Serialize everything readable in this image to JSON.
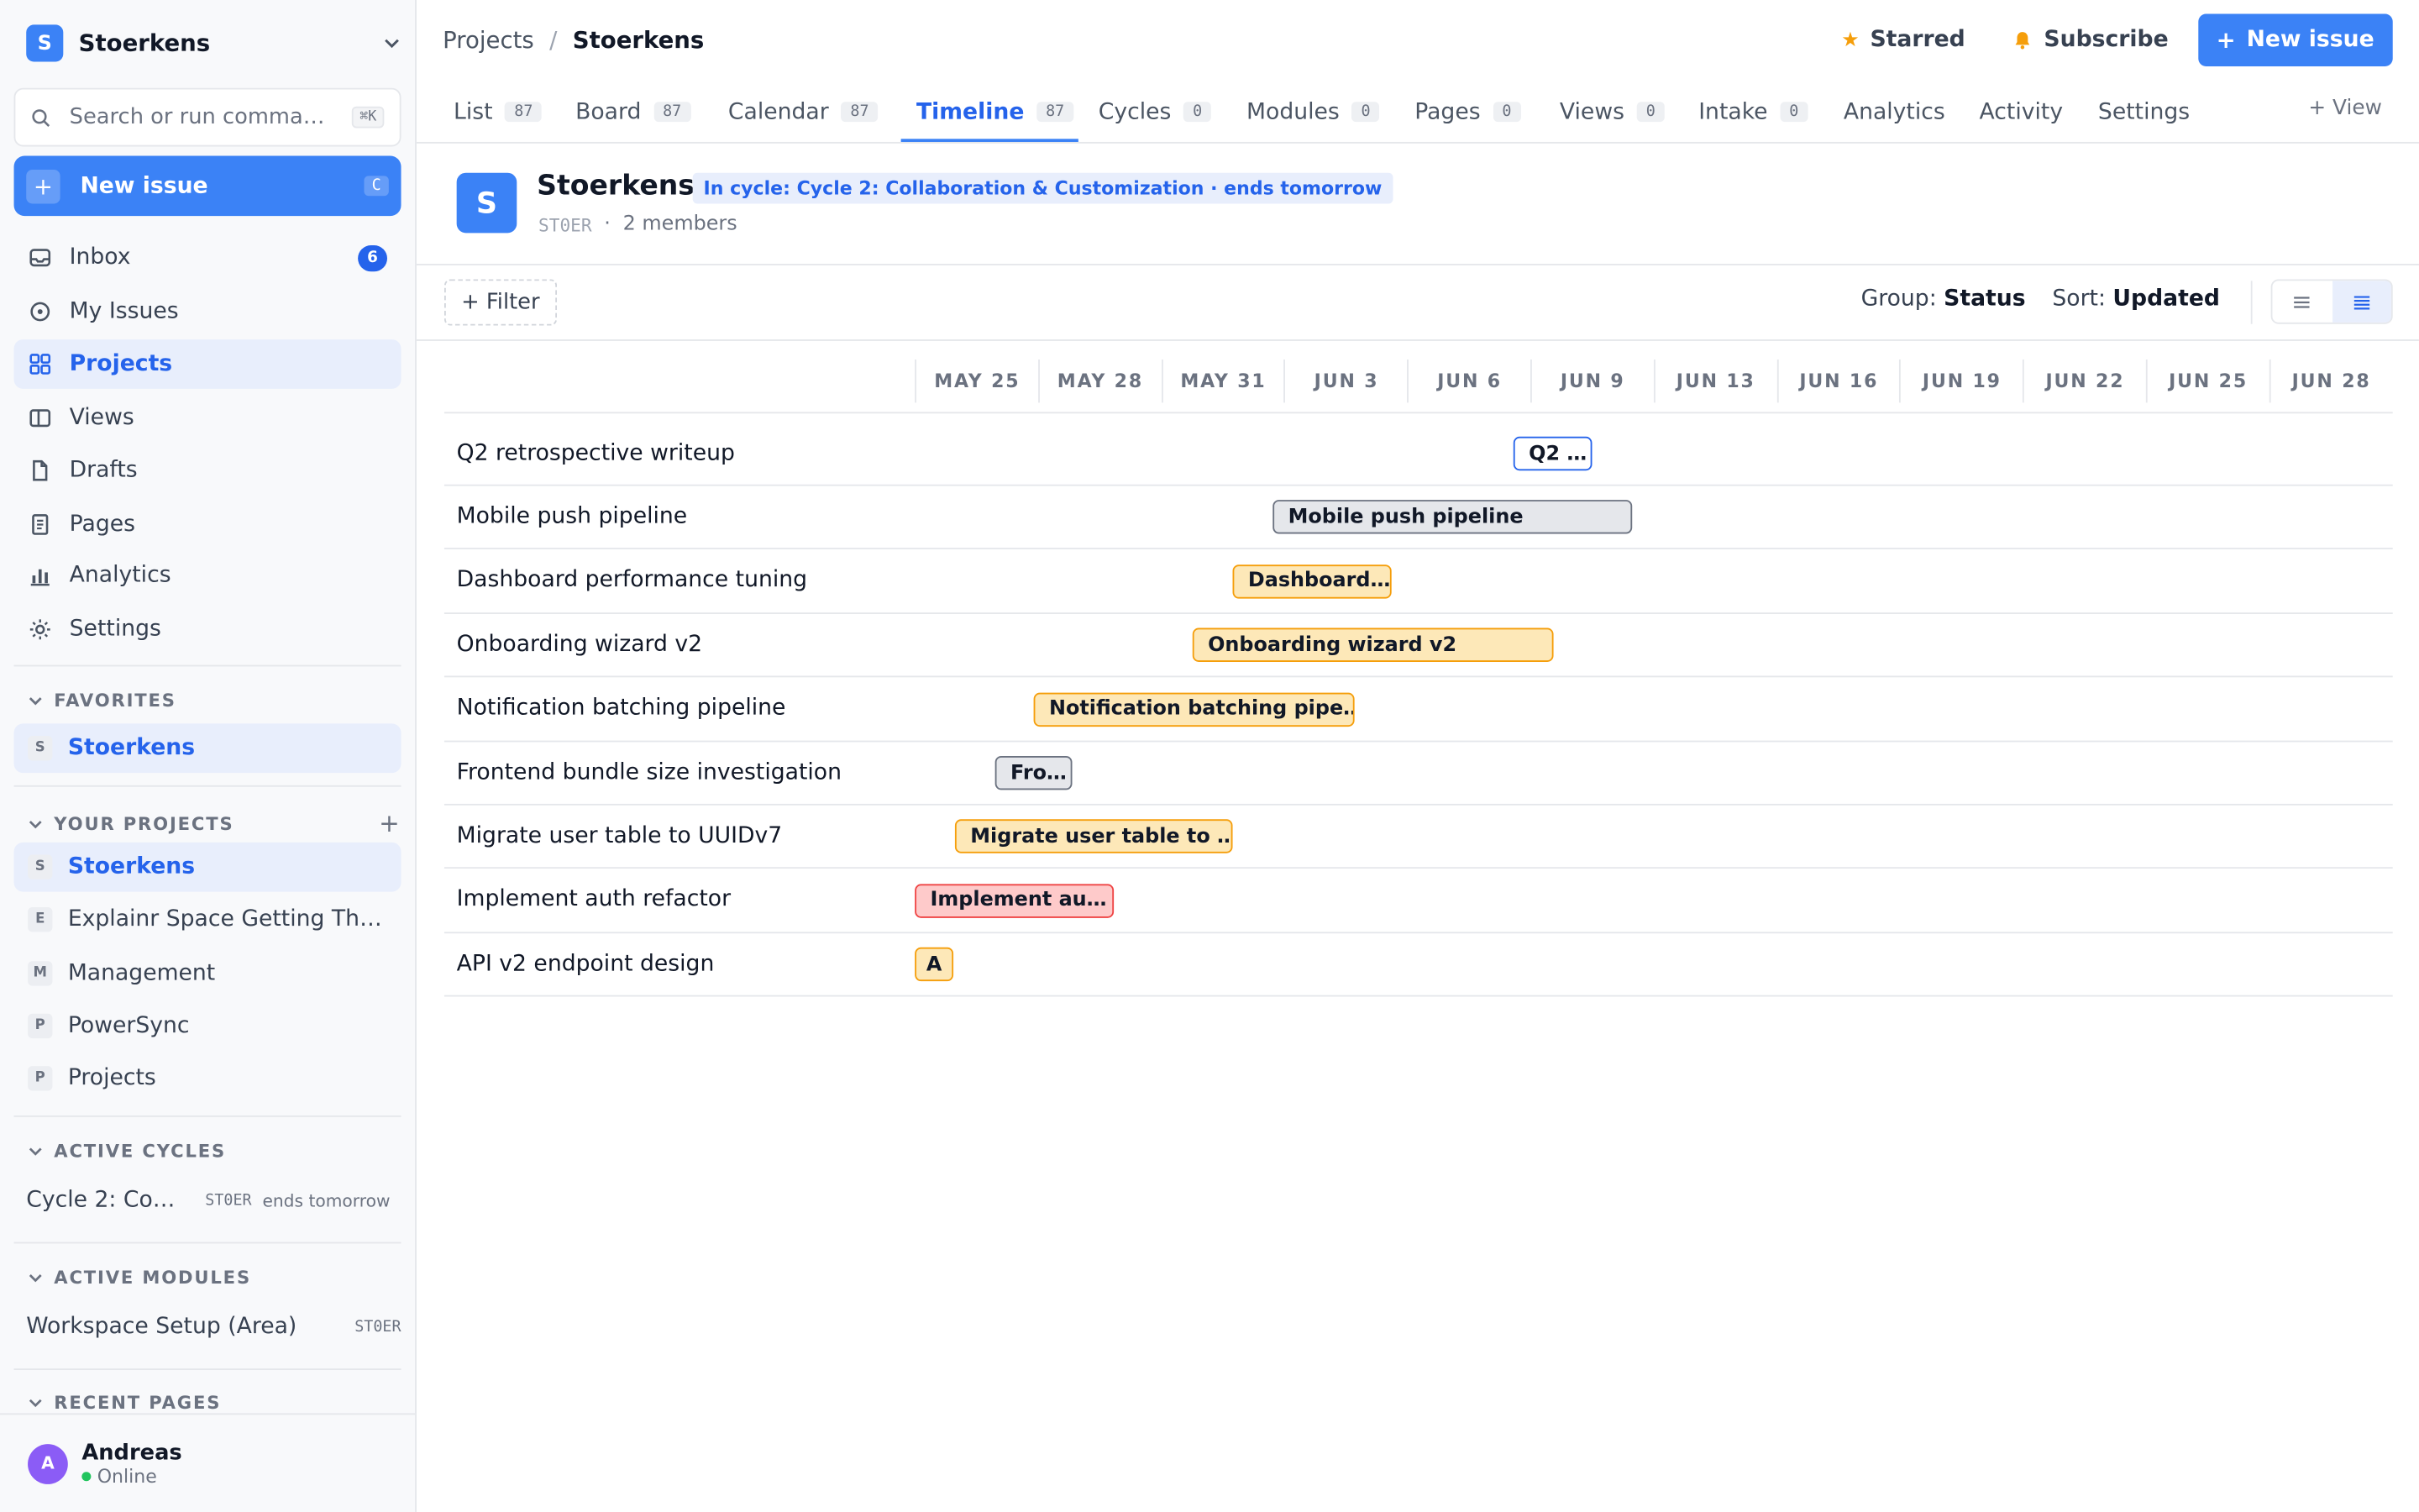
{
  "workspace": {
    "logo_letter": "S",
    "name": "Stoerkens"
  },
  "search": {
    "placeholder": "Search or run comma…",
    "shortcut": "⌘K"
  },
  "new_issue_sidebar": {
    "label": "New issue",
    "shortcut": "C"
  },
  "nav": [
    {
      "label": "Inbox",
      "icon": "inbox-icon",
      "badge": "6"
    },
    {
      "label": "My Issues",
      "icon": "target-icon"
    },
    {
      "label": "Projects",
      "icon": "grid-icon",
      "active": true
    },
    {
      "label": "Views",
      "icon": "views-icon"
    },
    {
      "label": "Drafts",
      "icon": "file-icon"
    },
    {
      "label": "Pages",
      "icon": "page-icon"
    },
    {
      "label": "Analytics",
      "icon": "bar-chart-icon"
    },
    {
      "label": "Settings",
      "icon": "gear-icon"
    }
  ],
  "favorites": {
    "heading": "FAVORITES",
    "items": [
      {
        "letter": "S",
        "label": "Stoerkens"
      }
    ]
  },
  "your_projects": {
    "heading": "YOUR PROJECTS",
    "items": [
      {
        "letter": "S",
        "label": "Stoerkens"
      },
      {
        "letter": "E",
        "label": "Explainr Space Getting Things Done"
      },
      {
        "letter": "M",
        "label": "Management"
      },
      {
        "letter": "P",
        "label": "PowerSync"
      },
      {
        "letter": "P",
        "label": "Projects"
      }
    ]
  },
  "active_cycles": {
    "heading": "ACTIVE CYCLES",
    "name": "Cycle 2: Collaboration & Customization",
    "project_id": "ST0ER",
    "due": "ends tomorrow"
  },
  "active_modules": {
    "heading": "ACTIVE MODULES",
    "name": "Workspace Setup (Area)",
    "project_id": "ST0ER"
  },
  "recent_pages": {
    "heading": "RECENT PAGES"
  },
  "user": {
    "initial": "A",
    "name": "Andreas",
    "status": "Online"
  },
  "breadcrumb": {
    "root": "Projects",
    "separator": "/",
    "current": "Stoerkens"
  },
  "actions": {
    "starred": "Starred",
    "subscribe": "Subscribe",
    "new_issue": "New issue"
  },
  "tabs": [
    {
      "label": "List",
      "count": "87"
    },
    {
      "label": "Board",
      "count": "87"
    },
    {
      "label": "Calendar",
      "count": "87"
    },
    {
      "label": "Timeline",
      "count": "87",
      "active": true
    },
    {
      "label": "Cycles",
      "count": "0"
    },
    {
      "label": "Modules",
      "count": "0"
    },
    {
      "label": "Pages",
      "count": "0"
    },
    {
      "label": "Views",
      "count": "0"
    },
    {
      "label": "Intake",
      "count": "0"
    },
    {
      "label": "Analytics"
    },
    {
      "label": "Activity"
    },
    {
      "label": "Settings"
    }
  ],
  "add_view": "+ View",
  "project": {
    "logo_letter": "S",
    "name": "Stoerkens",
    "cycle_badge": "In cycle: Cycle 2: Collaboration & Customization · ends tomorrow",
    "identifier": "ST0ER",
    "meta_separator": "·",
    "members": "2 members"
  },
  "toolbar": {
    "filter": "+ Filter",
    "group_label": "Group:",
    "group_value": "Status",
    "sort_label": "Sort:",
    "sort_value": "Updated"
  },
  "timeline": {
    "dates": [
      "MAY 25",
      "MAY 28",
      "MAY 31",
      "JUN 3",
      "JUN 6",
      "JUN 9",
      "JUN 13",
      "JUN 16",
      "JUN 19",
      "JUN 22",
      "JUN 25",
      "JUN 28"
    ],
    "rows": [
      {
        "title": "Q2 retrospective writeup",
        "bar_text": "Q2 …",
        "status": "backlog"
      },
      {
        "title": "Mobile push pipeline",
        "bar_text": "Mobile push pipeline",
        "status": "todo"
      },
      {
        "title": "Dashboard performance tuning",
        "bar_text": "Dashboard…",
        "status": "in-progress"
      },
      {
        "title": "Onboarding wizard v2",
        "bar_text": "Onboarding wizard v2",
        "status": "in-progress"
      },
      {
        "title": "Notification batching pipeline",
        "bar_text": "Notification batching pipe…",
        "status": "in-progress"
      },
      {
        "title": "Frontend bundle size investigation",
        "bar_text": "Fro…",
        "status": "todo"
      },
      {
        "title": "Migrate user table to UUIDv7",
        "bar_text": "Migrate user table to …",
        "status": "in-progress"
      },
      {
        "title": "Implement auth refactor",
        "bar_text": "Implement au…",
        "status": "urgent"
      },
      {
        "title": "API v2 endpoint design",
        "bar_text": "A",
        "status": "in-progress"
      }
    ]
  },
  "status_colors": {
    "backlog": {
      "bg": "#ffffff",
      "border": "#2563eb"
    },
    "todo": {
      "bg": "#e5e7eb",
      "border": "#6b7280"
    },
    "in-progress": {
      "bg": "#fde8b8",
      "border": "#f59e0b"
    },
    "urgent": {
      "bg": "#fecaca",
      "border": "#ef4444"
    }
  },
  "accent_color": "#3b82f6"
}
